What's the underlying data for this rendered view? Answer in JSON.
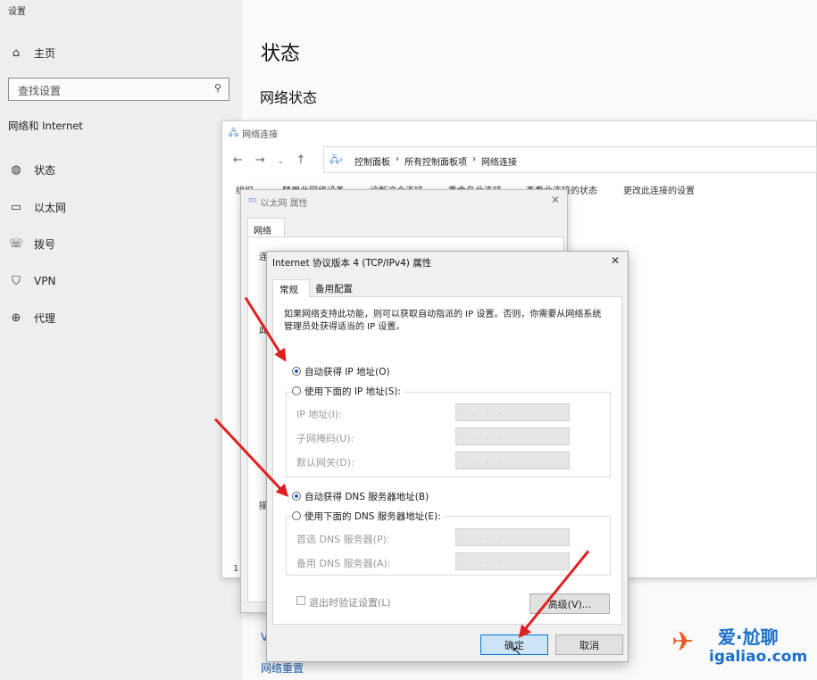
{
  "settings": {
    "app_title": "设置",
    "home": "主页",
    "search_placeholder": "查找设置",
    "section": "网络和 Internet",
    "nav": [
      {
        "icon": "globe-icon",
        "label": "状态"
      },
      {
        "icon": "ethernet-icon",
        "label": "以太网"
      },
      {
        "icon": "dialup-icon",
        "label": "拨号"
      },
      {
        "icon": "vpn-icon",
        "label": "VPN"
      },
      {
        "icon": "proxy-icon",
        "label": "代理"
      }
    ],
    "page_title": "状态",
    "subtitle": "网络状态",
    "reset_link": "网络重置",
    "partial_link": "V"
  },
  "netconn": {
    "title": "网络连接",
    "breadcrumb": [
      "控制面板",
      "所有控制面板项",
      "网络连接"
    ],
    "toolbar": [
      "组织",
      "禁用此网络设备",
      "诊断这个连接",
      "重命名此连接",
      "查看此连接的状态",
      "更改此连接的设置"
    ],
    "bottom_char": "1"
  },
  "eth": {
    "title": "以太网 属性",
    "tab": "网络",
    "c1": "连",
    "c2": "此",
    "c3": "描"
  },
  "tcp": {
    "title": "Internet 协议版本 4 (TCP/IPv4) 属性",
    "tabs": [
      "常规",
      "备用配置"
    ],
    "desc": "如果网络支持此功能，则可以获取自动指派的 IP 设置。否则，你需要从网络系统管理员处获得适当的 IP 设置。",
    "auto_ip": "自动获得 IP 地址(O)",
    "manual_ip": "使用下面的 IP 地址(S):",
    "ip_label": "IP 地址(I):",
    "mask_label": "子网掩码(U):",
    "gw_label": "默认网关(D):",
    "auto_dns": "自动获得 DNS 服务器地址(B)",
    "manual_dns": "使用下面的 DNS 服务器地址(E):",
    "dns1_label": "首选 DNS 服务器(P):",
    "dns2_label": "备用 DNS 服务器(A):",
    "validate": "退出时验证设置(L)",
    "advanced": "高级(V)...",
    "ok": "确定",
    "cancel": "取消",
    "field_dots": "..."
  },
  "watermark": {
    "brand": "爱·尬聊",
    "site": "igaliao.com"
  },
  "colors": {
    "accent": "#1a5fb4",
    "arrow": "#e02020"
  }
}
